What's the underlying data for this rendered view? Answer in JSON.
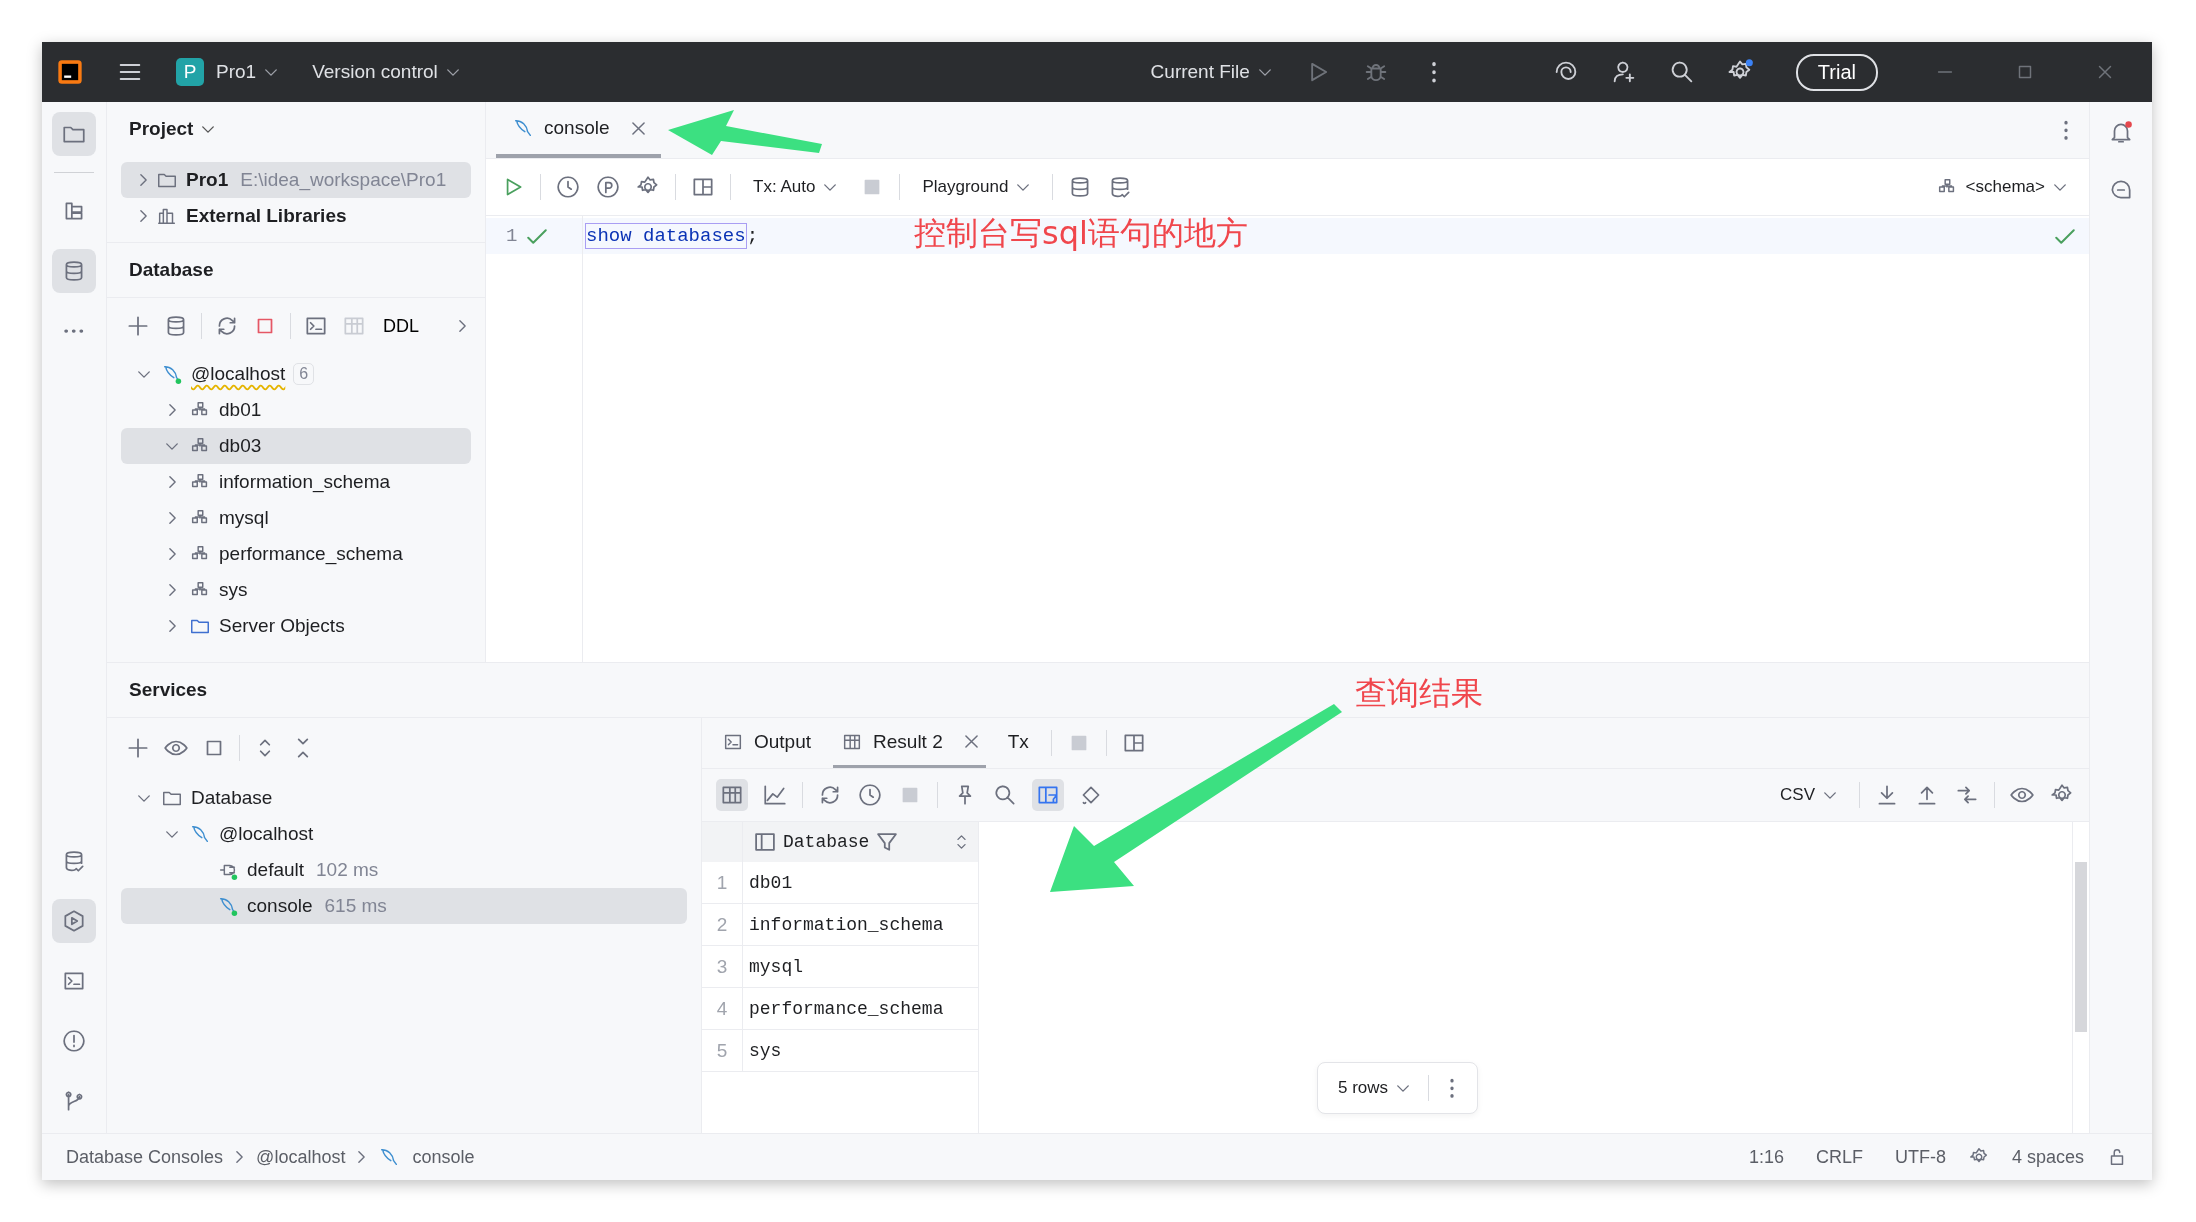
{
  "titlebar": {
    "project_badge": "P",
    "project": "Pro1",
    "vcs": "Version control",
    "run_config": "Current File",
    "trial": "Trial"
  },
  "project_panel": {
    "title": "Project",
    "items": [
      {
        "name": "Pro1",
        "path": "E:\\idea_workspace\\Pro1",
        "kind": "project",
        "selected": true
      },
      {
        "name": "External Libraries",
        "kind": "libraries",
        "selected": false
      }
    ]
  },
  "database_panel": {
    "title": "Database",
    "toolbar_label": "DDL",
    "tree": [
      {
        "name": "@localhost",
        "badge": "6",
        "kind": "host",
        "expanded": true,
        "selected": false,
        "children": [
          {
            "name": "db01",
            "kind": "schema",
            "expanded": false,
            "selected": false
          },
          {
            "name": "db03",
            "kind": "schema",
            "expanded": true,
            "selected": true
          },
          {
            "name": "information_schema",
            "kind": "schema",
            "expanded": false,
            "selected": false
          },
          {
            "name": "mysql",
            "kind": "schema",
            "expanded": false,
            "selected": false
          },
          {
            "name": "performance_schema",
            "kind": "schema",
            "expanded": false,
            "selected": false
          },
          {
            "name": "sys",
            "kind": "schema",
            "expanded": false,
            "selected": false
          },
          {
            "name": "Server Objects",
            "kind": "server_objects",
            "expanded": false,
            "selected": false
          }
        ]
      }
    ]
  },
  "editor": {
    "tabs": [
      {
        "label": "console",
        "selected": true
      }
    ],
    "tx": "Tx: Auto",
    "mode": "Playground",
    "schema": "<schema>",
    "lines": [
      {
        "number": "1",
        "highlighted": "show databases",
        "rest": ";"
      }
    ]
  },
  "annotations": [
    {
      "text": "控制台写sql语句的地方"
    },
    {
      "text": "查询结果"
    }
  ],
  "services": {
    "title": "Services",
    "tree": [
      {
        "name": "Database",
        "kind": "folder",
        "expanded": true,
        "selected": false,
        "children": [
          {
            "name": "@localhost",
            "kind": "host_plain",
            "expanded": true,
            "selected": false,
            "children": [
              {
                "name": "default",
                "time": "102 ms",
                "kind": "session",
                "selected": false
              },
              {
                "name": "console",
                "time": "615 ms",
                "kind": "console",
                "selected": true
              }
            ]
          }
        ]
      }
    ]
  },
  "results": {
    "tabs": [
      {
        "label": "Output",
        "kind": "output",
        "selected": false
      },
      {
        "label": "Result 2",
        "kind": "result",
        "selected": true
      },
      {
        "label": "Tx",
        "kind": "tx",
        "selected": false
      }
    ],
    "export_format": "CSV",
    "column": "Database",
    "rows": [
      {
        "number": "1",
        "value": "db01"
      },
      {
        "number": "2",
        "value": "information_schema"
      },
      {
        "number": "3",
        "value": "mysql"
      },
      {
        "number": "4",
        "value": "performance_schema"
      },
      {
        "number": "5",
        "value": "sys"
      }
    ],
    "row_count": "5 rows"
  },
  "status_bar": {
    "breadcrumbs": [
      "Database Consoles",
      "@localhost",
      "console"
    ],
    "position": "1:16",
    "line_ending": "CRLF",
    "encoding": "UTF-8",
    "indent": "4 spaces"
  }
}
